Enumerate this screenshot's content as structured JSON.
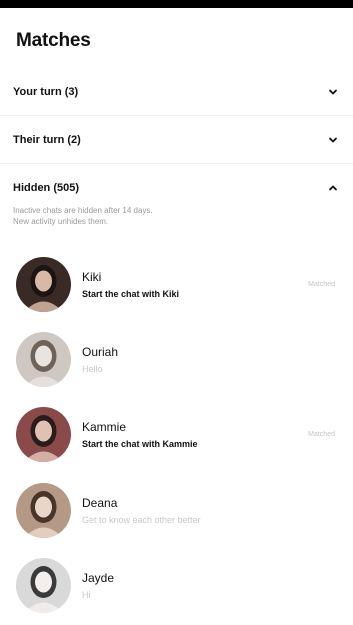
{
  "header": {
    "title": "Matches"
  },
  "sections": {
    "your_turn": {
      "label": "Your turn (3)"
    },
    "their_turn": {
      "label": "Their turn (2)"
    },
    "hidden": {
      "label": "Hidden (505)",
      "note_line1": "Inactive chats are hidden after 14 days.",
      "note_line2": "New activity unhides them."
    }
  },
  "matches": [
    {
      "name": "Kiki",
      "subtitle": "Start the chat with Kiki",
      "tag": "Matched",
      "colors": [
        "#3a2a26",
        "#d7b9a5",
        "#1c1412"
      ]
    },
    {
      "name": "Ouriah",
      "subtitle": "Hello",
      "tag": "",
      "colors": [
        "#cfc8c2",
        "#e9e4df",
        "#6f6258"
      ]
    },
    {
      "name": "Kammie",
      "subtitle": "Start the chat with Kammie",
      "tag": "Matched",
      "colors": [
        "#8a4a4a",
        "#e0c2b4",
        "#2a1c1c"
      ]
    },
    {
      "name": "Deana",
      "subtitle": "Get to know each other better",
      "tag": "",
      "colors": [
        "#b49a86",
        "#ead6c8",
        "#4a3428"
      ]
    },
    {
      "name": "Jayde",
      "subtitle": "Hi",
      "tag": "",
      "colors": [
        "#d9d9d9",
        "#f2efec",
        "#3a3a3a"
      ]
    }
  ],
  "icons": {
    "chevron_down": "chevron-down-icon",
    "chevron_up": "chevron-up-icon"
  }
}
